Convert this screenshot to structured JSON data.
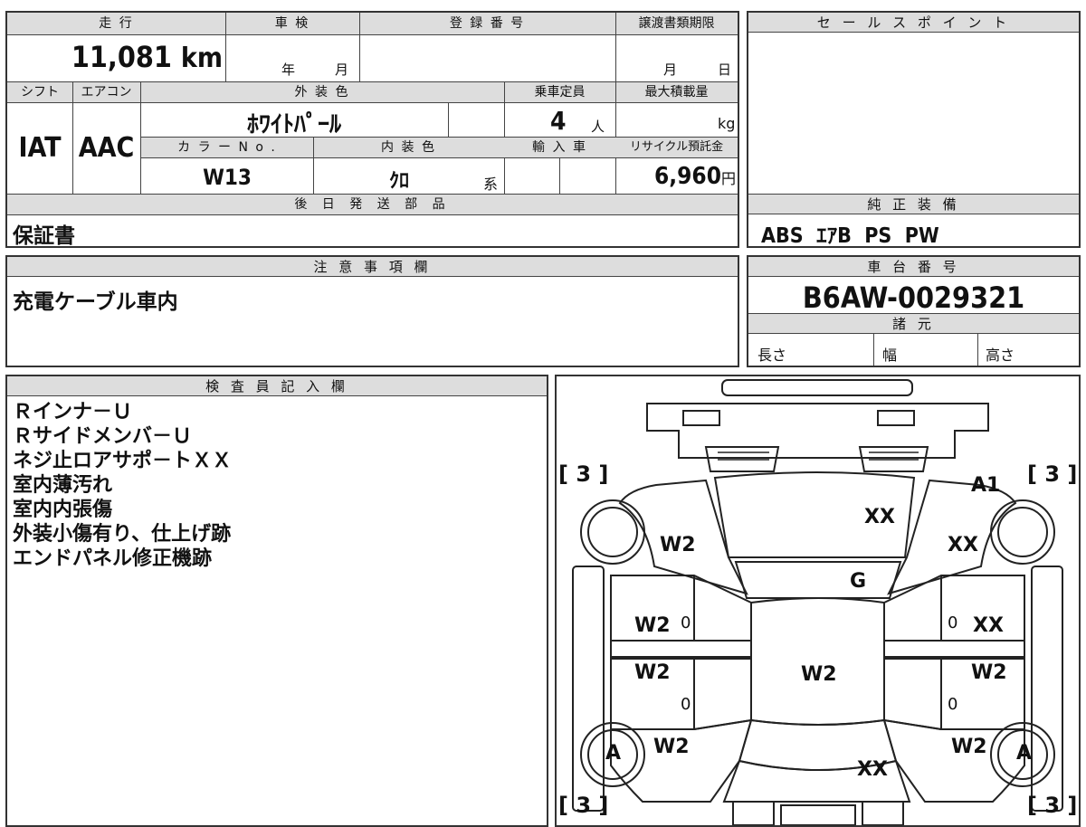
{
  "top_table": {
    "mileage": {
      "label": "走 行",
      "value": "11,081",
      "unit": "km"
    },
    "inspection": {
      "label": "車 検",
      "year_label": "年",
      "month_label": "月"
    },
    "registration": {
      "label": "登 録 番 号"
    },
    "transfer_deadline": {
      "label": "譲渡書類期限",
      "month_label": "月",
      "day_label": "日"
    },
    "shift": {
      "label": "シフト",
      "value": "IAT"
    },
    "aircon": {
      "label": "エアコン",
      "value": "AAC"
    },
    "exterior_color": {
      "label": "外 装 色",
      "value": "ﾎﾜｲﾄﾊﾟｰﾙ"
    },
    "capacity": {
      "label": "乗車定員",
      "value": "4",
      "unit": "人"
    },
    "max_load": {
      "label": "最大積載量",
      "unit": "kg"
    },
    "color_no": {
      "label": "カ ラ ー N o .",
      "value": "W13"
    },
    "interior_color": {
      "label": "内 装 色",
      "value": "ｸﾛ",
      "suffix": "系"
    },
    "import": {
      "label": "輸 入 車"
    },
    "recycle_fee": {
      "label": "リサイクル預託金",
      "value": "6,960",
      "unit": "円"
    },
    "later_parts": {
      "label": "後 日 発 送 部 品",
      "value": "保証書"
    }
  },
  "sale_point": {
    "label": "セ ー ル ス ポ イ ン ト"
  },
  "genuine_equipment": {
    "label": "純 正 装 備",
    "value": "ABS  ｴｱB  PS  PW"
  },
  "caution": {
    "label": "注 意 事 項 欄",
    "value": "充電ケーブル車内"
  },
  "chassis": {
    "label": "車 台 番 号",
    "value": "B6AW-0029321"
  },
  "specs": {
    "label": "諸 元",
    "length": "長さ",
    "width": "幅",
    "height": "高さ"
  },
  "inspector": {
    "label": "検 査 員 記 入 欄",
    "lines": [
      "Ｒインナ－Ｕ",
      "Ｒサイドメンバ－Ｕ",
      "ネジ止ロアサポ－トＸＸ",
      "室内薄汚れ",
      "室内内張傷",
      "外装小傷有り、仕上げ跡",
      "エンドパネル修正機跡"
    ]
  },
  "diagram": {
    "brackets": {
      "fl": "3",
      "fr": "3",
      "rl": "3",
      "rr": "3"
    },
    "marks": {
      "a1": "A1",
      "hood": "XX",
      "fender_l": "W2",
      "fender_r": "XX",
      "windshield": "G",
      "door_fl": "W2",
      "door_fl_0": "0",
      "door_fr_0": "0",
      "door_fr": "XX",
      "door_rl": "W2",
      "door_rl_0": "0",
      "roof": "W2",
      "door_rr": "W2",
      "door_rr_0": "0",
      "quarter_l": "W2",
      "quarter_r": "W2",
      "wheel_rl": "A",
      "wheel_rr": "A",
      "trunk": "XX"
    }
  }
}
